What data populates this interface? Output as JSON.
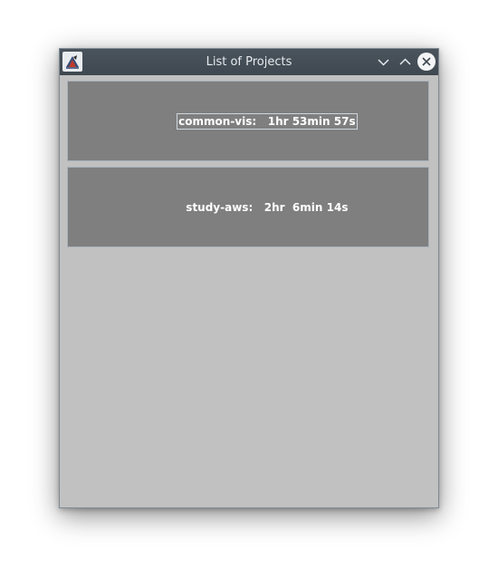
{
  "window": {
    "title": "List of Projects"
  },
  "titlebar": {
    "icons": {
      "app": "app-logo-icon",
      "minimize": "chevron-down-icon",
      "maximize": "chevron-up-icon",
      "close": "close-icon"
    }
  },
  "projects": [
    {
      "label": "common-vis:   1hr 53min 57s"
    },
    {
      "label": "study-aws:   2hr  6min 14s"
    }
  ],
  "colors": {
    "titlebar": "#474f58",
    "content_background": "#c1c1c1",
    "card_background": "#7f7f7f",
    "card_text": "#ffffff",
    "focus_border": "#cdd6de"
  }
}
